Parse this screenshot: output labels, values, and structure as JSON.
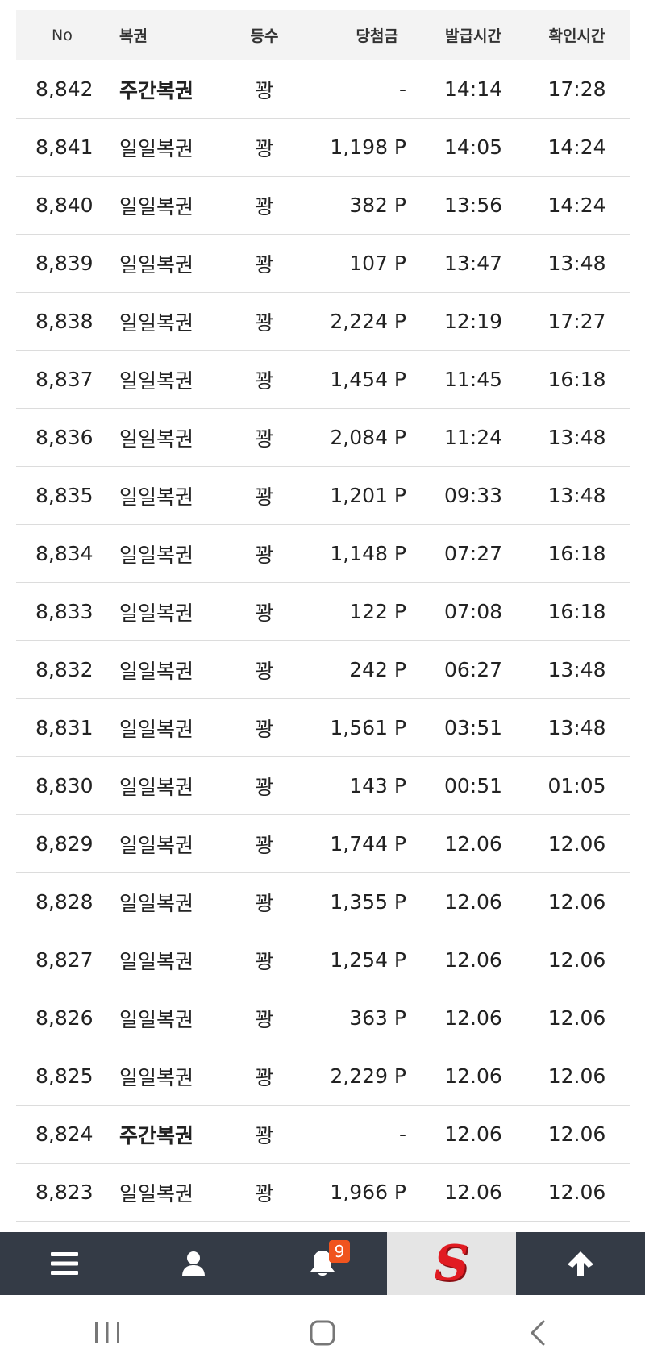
{
  "table": {
    "headers": {
      "no": "No",
      "type": "복권",
      "rank": "등수",
      "prize": "당첨금",
      "issued": "발급시간",
      "checked": "확인시간"
    },
    "rows": [
      {
        "no": "8,842",
        "type": "주간복권",
        "rank": "꽝",
        "prize": "-",
        "issued": "14:14",
        "checked": "17:28"
      },
      {
        "no": "8,841",
        "type": "일일복권",
        "rank": "꽝",
        "prize": "1,198 P",
        "issued": "14:05",
        "checked": "14:24"
      },
      {
        "no": "8,840",
        "type": "일일복권",
        "rank": "꽝",
        "prize": "382 P",
        "issued": "13:56",
        "checked": "14:24"
      },
      {
        "no": "8,839",
        "type": "일일복권",
        "rank": "꽝",
        "prize": "107 P",
        "issued": "13:47",
        "checked": "13:48"
      },
      {
        "no": "8,838",
        "type": "일일복권",
        "rank": "꽝",
        "prize": "2,224 P",
        "issued": "12:19",
        "checked": "17:27"
      },
      {
        "no": "8,837",
        "type": "일일복권",
        "rank": "꽝",
        "prize": "1,454 P",
        "issued": "11:45",
        "checked": "16:18"
      },
      {
        "no": "8,836",
        "type": "일일복권",
        "rank": "꽝",
        "prize": "2,084 P",
        "issued": "11:24",
        "checked": "13:48"
      },
      {
        "no": "8,835",
        "type": "일일복권",
        "rank": "꽝",
        "prize": "1,201 P",
        "issued": "09:33",
        "checked": "13:48"
      },
      {
        "no": "8,834",
        "type": "일일복권",
        "rank": "꽝",
        "prize": "1,148 P",
        "issued": "07:27",
        "checked": "16:18"
      },
      {
        "no": "8,833",
        "type": "일일복권",
        "rank": "꽝",
        "prize": "122 P",
        "issued": "07:08",
        "checked": "16:18"
      },
      {
        "no": "8,832",
        "type": "일일복권",
        "rank": "꽝",
        "prize": "242 P",
        "issued": "06:27",
        "checked": "13:48"
      },
      {
        "no": "8,831",
        "type": "일일복권",
        "rank": "꽝",
        "prize": "1,561 P",
        "issued": "03:51",
        "checked": "13:48"
      },
      {
        "no": "8,830",
        "type": "일일복권",
        "rank": "꽝",
        "prize": "143 P",
        "issued": "00:51",
        "checked": "01:05"
      },
      {
        "no": "8,829",
        "type": "일일복권",
        "rank": "꽝",
        "prize": "1,744 P",
        "issued": "12.06",
        "checked": "12.06"
      },
      {
        "no": "8,828",
        "type": "일일복권",
        "rank": "꽝",
        "prize": "1,355 P",
        "issued": "12.06",
        "checked": "12.06"
      },
      {
        "no": "8,827",
        "type": "일일복권",
        "rank": "꽝",
        "prize": "1,254 P",
        "issued": "12.06",
        "checked": "12.06"
      },
      {
        "no": "8,826",
        "type": "일일복권",
        "rank": "꽝",
        "prize": "363 P",
        "issued": "12.06",
        "checked": "12.06"
      },
      {
        "no": "8,825",
        "type": "일일복권",
        "rank": "꽝",
        "prize": "2,229 P",
        "issued": "12.06",
        "checked": "12.06"
      },
      {
        "no": "8,824",
        "type": "주간복권",
        "rank": "꽝",
        "prize": "-",
        "issued": "12.06",
        "checked": "12.06"
      },
      {
        "no": "8,823",
        "type": "일일복권",
        "rank": "꽝",
        "prize": "1,966 P",
        "issued": "12.06",
        "checked": "12.06"
      }
    ]
  },
  "bottom_nav": {
    "items": [
      {
        "name": "menu-icon"
      },
      {
        "name": "user-icon"
      },
      {
        "name": "bell-icon",
        "badge": "9"
      },
      {
        "name": "brand-logo-icon",
        "glyph": "S"
      },
      {
        "name": "arrow-up-icon"
      }
    ]
  },
  "colors": {
    "nav_bg": "#343b46",
    "badge": "#f0541e",
    "brand_red": "#e11b22",
    "header_bg": "#f3f3f3"
  }
}
